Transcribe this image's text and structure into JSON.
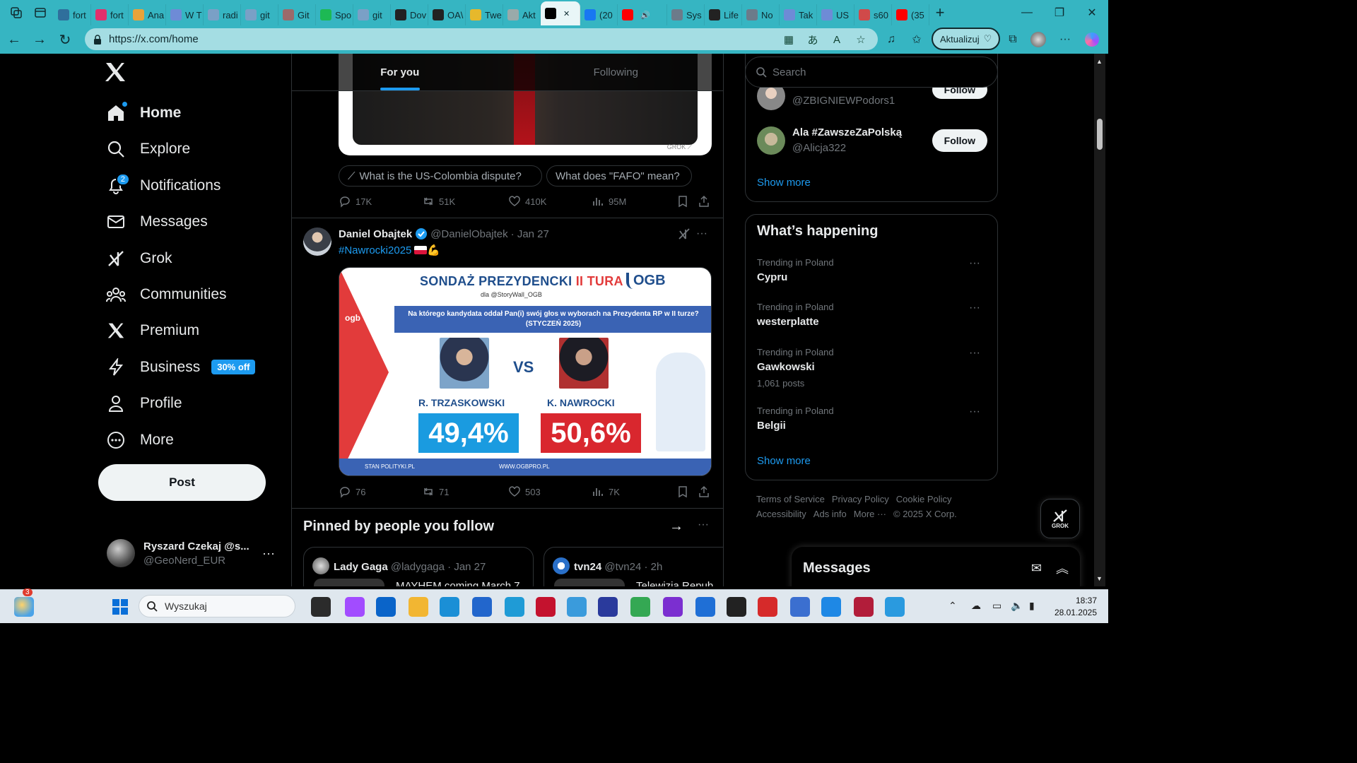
{
  "browser": {
    "tabs": [
      {
        "label": "fort",
        "color": "#2f6f9c"
      },
      {
        "label": "fort",
        "color": "#e1306c"
      },
      {
        "label": "Ana",
        "color": "#e8a33a"
      },
      {
        "label": "W T",
        "color": "#6e8bd6"
      },
      {
        "label": "radi",
        "color": "#7aa0c6"
      },
      {
        "label": "git",
        "color": "#7aa0c6"
      },
      {
        "label": "Git",
        "color": "#9b6a6a"
      },
      {
        "label": "Spo",
        "color": "#1db954"
      },
      {
        "label": "git",
        "color": "#7aa0c6"
      },
      {
        "label": "Dov",
        "color": "#222222"
      },
      {
        "label": "OA\\",
        "color": "#222222"
      },
      {
        "label": "Twe",
        "color": "#e6b82c"
      },
      {
        "label": "Akt",
        "color": "#9aa"
      },
      {
        "label": "",
        "color": "#000000",
        "active": true
      },
      {
        "label": "(20",
        "color": "#1877f2"
      },
      {
        "label": "",
        "color": "#ff0000",
        "audio": true
      },
      {
        "label": "Sys",
        "color": "#6c7b8a"
      },
      {
        "label": "Life",
        "color": "#222222"
      },
      {
        "label": "No",
        "color": "#6c7b8a"
      },
      {
        "label": "Tak",
        "color": "#6e8bd6"
      },
      {
        "label": "US",
        "color": "#6e8bd6"
      },
      {
        "label": "s60",
        "color": "#d04a4a"
      },
      {
        "label": "(35",
        "color": "#ff0000"
      }
    ],
    "url": "https://x.com/home",
    "update_label": "Aktualizuj"
  },
  "nav": {
    "items": [
      {
        "label": "Home",
        "icon": "home-icon",
        "bold": true
      },
      {
        "label": "Explore",
        "icon": "search-icon"
      },
      {
        "label": "Notifications",
        "icon": "bell-icon",
        "badge": "2"
      },
      {
        "label": "Messages",
        "icon": "envelope-icon"
      },
      {
        "label": "Grok",
        "icon": "grok-icon"
      },
      {
        "label": "Communities",
        "icon": "communities-icon"
      },
      {
        "label": "Premium",
        "icon": "x-logo-icon"
      },
      {
        "label": "Business",
        "icon": "lightning-icon",
        "promo": "30% off"
      },
      {
        "label": "Profile",
        "icon": "person-icon"
      },
      {
        "label": "More",
        "icon": "more-circle-icon"
      }
    ],
    "post_label": "Post",
    "account": {
      "name": "Ryszard Czekaj @s...",
      "handle": "@GeoNerd_EUR"
    }
  },
  "feed": {
    "tabs": [
      "For you",
      "Following"
    ],
    "tweet1": {
      "chips": [
        "What is the US-Colombia dispute?",
        "What does \"FAFO\" mean?"
      ],
      "replies": "17K",
      "reposts": "51K",
      "likes": "410K",
      "views": "95M"
    },
    "tweet2": {
      "name": "Daniel Obajtek",
      "handle": "@DanielObajtek",
      "date": "· Jan 27",
      "hashtag": "#Nawrocki2025",
      "emoji": "💪",
      "image": {
        "title_a": "SONDAŻ PREZYDENCKI ",
        "title_b": "II TURA",
        "logo": "OGB",
        "side_logo": "ogb",
        "sub": "dla @StoryWall_OGB",
        "question": "Na którego kandydata oddał Pan(i) swój głos w wyborach na Prezydenta RP w II turze? (STYCZEŃ 2025)",
        "vs": "VS",
        "cand1": "R. TRZASKOWSKI",
        "cand2": "K. NAWROCKI",
        "pct1": "49,4%",
        "pct2": "50,6%",
        "foot_left": "STAN POLITYKI.PL",
        "foot_mid": "WWW.OGBPRO.PL"
      },
      "replies": "76",
      "reposts": "71",
      "likes": "503",
      "views": "7K"
    },
    "pinned": {
      "title": "Pinned by people you follow",
      "cards": [
        {
          "name": "Lady Gaga",
          "handle": "@ladygaga · Jan 27",
          "text": "MAYHEM coming March 7"
        },
        {
          "name": "tvn24",
          "handle": "@tvn24 · 2h",
          "text": "Telewizja Repub"
        }
      ]
    }
  },
  "right": {
    "search_placeholder": "Search",
    "who_to_follow": [
      {
        "name": "",
        "handle": "@ZBIGNIEWPodors1",
        "button": "Follow"
      },
      {
        "name": "Ala #ZawszeZaPolską",
        "handle": "@Alicja322",
        "button": "Follow"
      }
    ],
    "show_more": "Show more",
    "happening": {
      "title": "What’s happening",
      "trends": [
        {
          "context": "Trending in Poland",
          "topic": "Cypru",
          "count": ""
        },
        {
          "context": "Trending in Poland",
          "topic": "westerplatte",
          "count": ""
        },
        {
          "context": "Trending in Poland",
          "topic": "Gawkowski",
          "count": "1,061 posts"
        },
        {
          "context": "Trending in Poland",
          "topic": "Belgii",
          "count": ""
        }
      ],
      "show_more": "Show more"
    },
    "footer": [
      "Terms of Service",
      "Privacy Policy",
      "Cookie Policy",
      "Accessibility",
      "Ads info",
      "More ···",
      "© 2025 X Corp."
    ],
    "grok_label": "GROK",
    "messages_title": "Messages"
  },
  "taskbar": {
    "search_placeholder": "Wyszukaj",
    "weather_badge": "3",
    "time": "18:37",
    "date": "28.01.2025"
  },
  "colors": {
    "accent": "#1d9bf0",
    "browser": "#36b5c2"
  }
}
